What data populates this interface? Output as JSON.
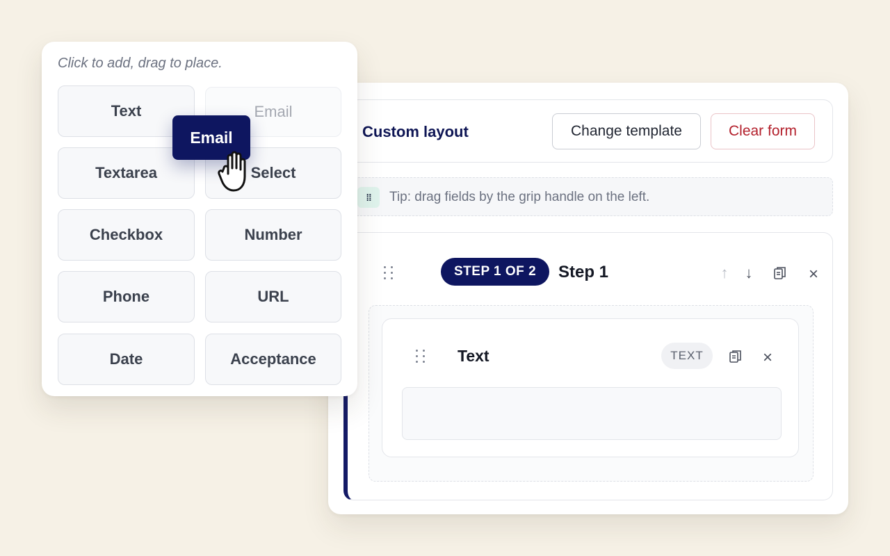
{
  "palette": {
    "hint": "Click to add, drag to place.",
    "tiles": [
      {
        "label": "Text"
      },
      {
        "label": "Email"
      },
      {
        "label": "Textarea"
      },
      {
        "label": "Select"
      },
      {
        "label": "Checkbox"
      },
      {
        "label": "Number"
      },
      {
        "label": "Phone"
      },
      {
        "label": "URL"
      },
      {
        "label": "Date"
      },
      {
        "label": "Acceptance"
      }
    ],
    "dragging": {
      "label": "Email"
    }
  },
  "builder": {
    "layout_title": "Custom layout",
    "change_template_label": "Change template",
    "clear_form_label": "Clear form",
    "tip": "Tip: drag fields by the grip handle on the left.",
    "tip_icon": "grip-icon",
    "step": {
      "badge": "STEP 1 OF 2",
      "title": "Step 1",
      "actions": [
        "arrow-up-icon",
        "arrow-down-icon",
        "duplicate-icon",
        "close-icon"
      ]
    },
    "field": {
      "title": "Text",
      "type_badge": "TEXT",
      "actions": [
        "duplicate-icon",
        "close-icon"
      ]
    }
  },
  "colors": {
    "background": "#f6f1e6",
    "accent_navy": "#0e1660",
    "danger": "#b3202c",
    "tip_icon_bg": "#dff3ec"
  }
}
